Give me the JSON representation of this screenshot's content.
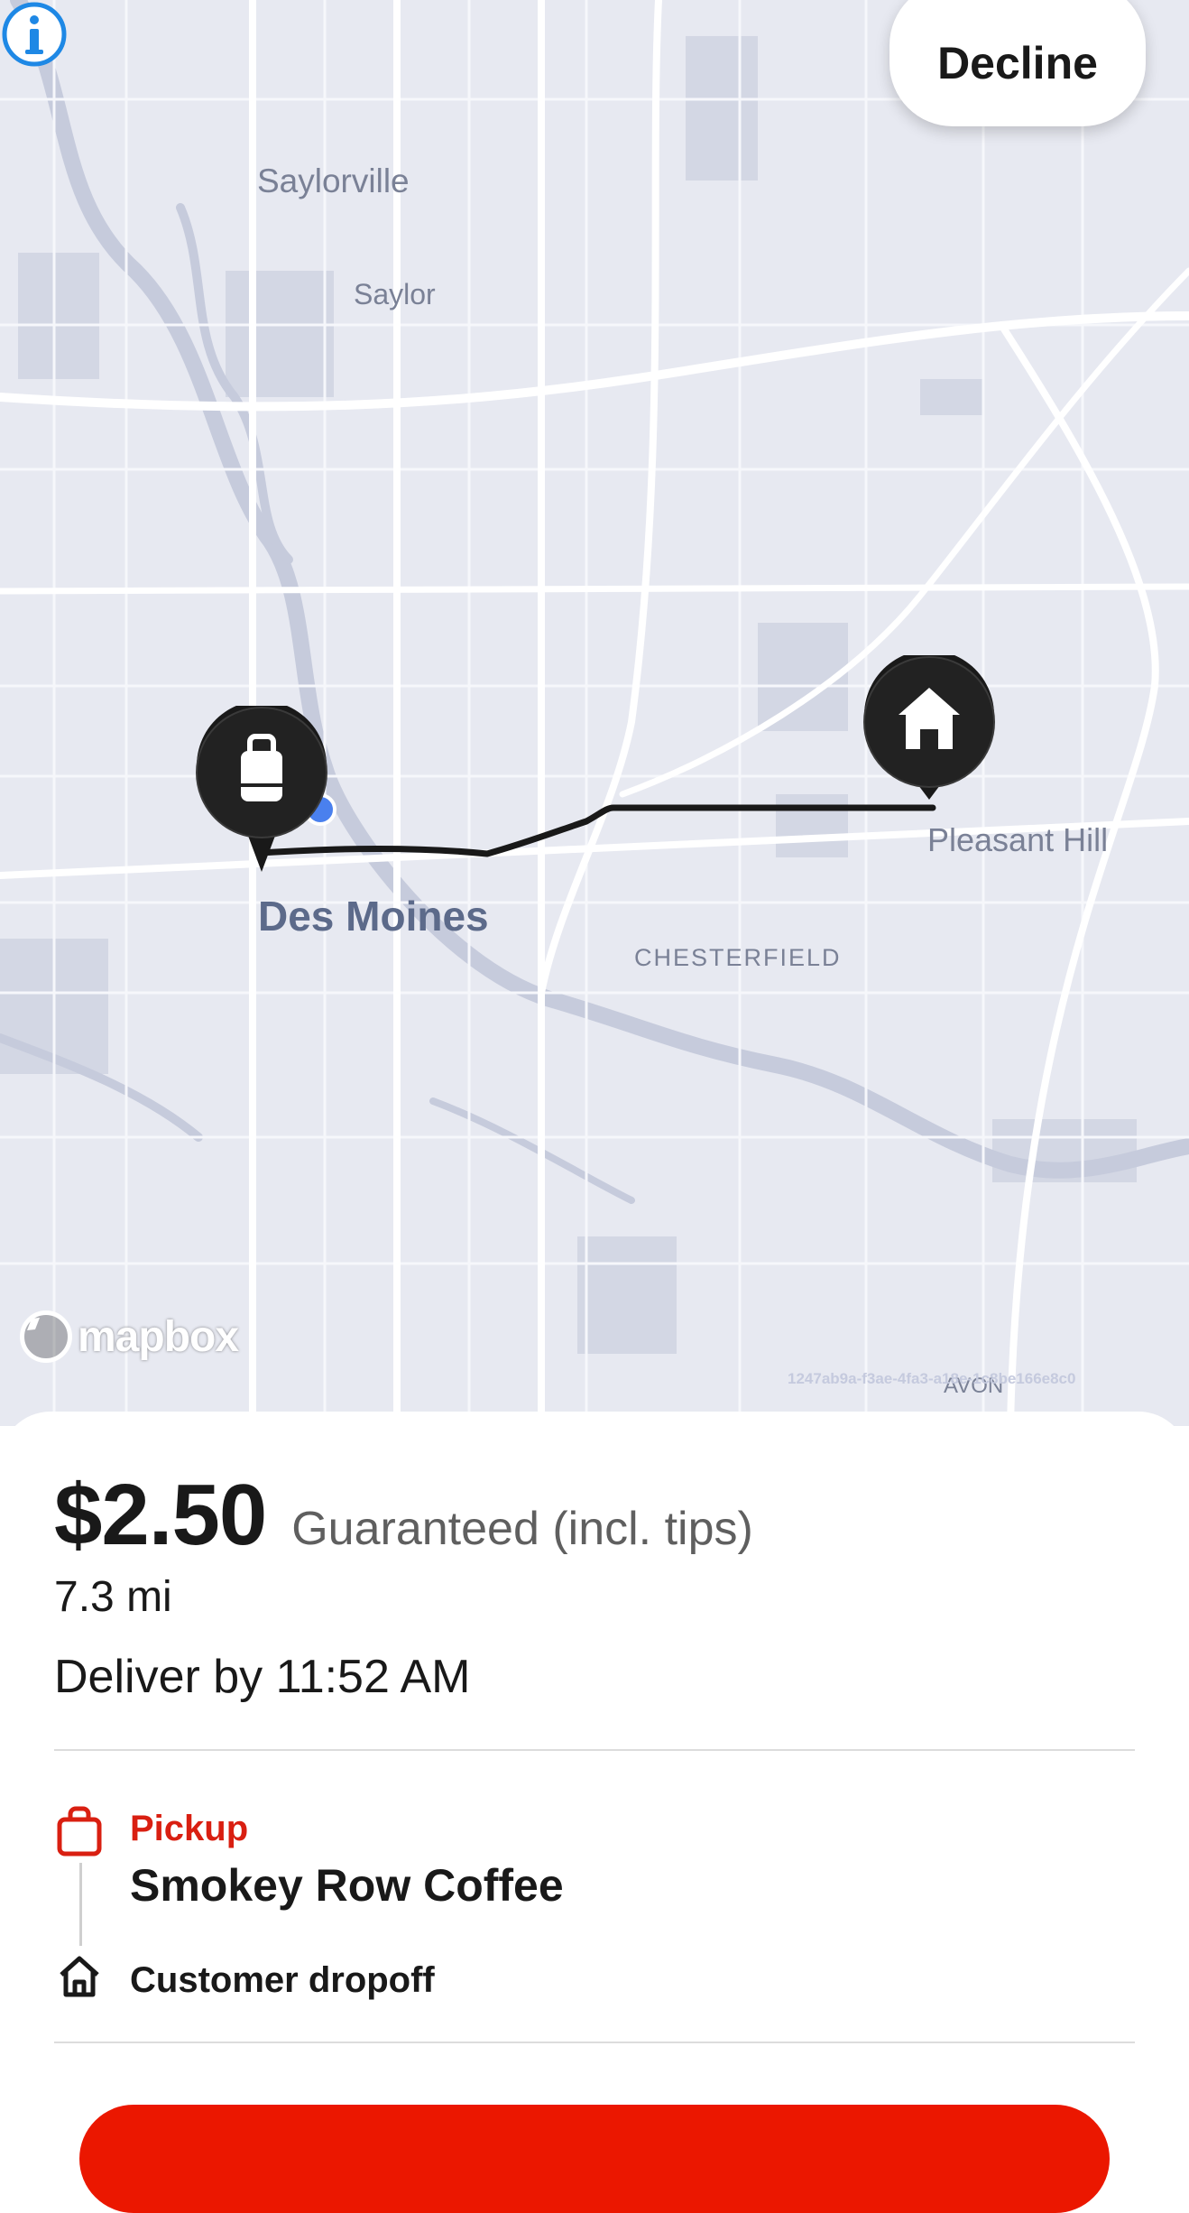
{
  "header": {
    "decline_label": "Decline"
  },
  "map": {
    "labels": {
      "saylorville": "Saylorville",
      "saylor": "Saylor",
      "des_moines": "Des Moines",
      "chesterfield": "CHESTERFIELD",
      "pleasant_hill": "Pleasant Hill",
      "avon": "AVON"
    },
    "attribution": {
      "logo_text": "mapbox",
      "id_text": "1247ab9a-f3ae-4fa3-a18e-1c8be166e8c0"
    },
    "pins": {
      "pickup_icon": "bag-icon",
      "dropoff_icon": "home-icon"
    }
  },
  "offer": {
    "price": "$2.50",
    "price_note": "Guaranteed (incl. tips)",
    "distance": "7.3 mi",
    "deliver_by": "Deliver by 11:52 AM"
  },
  "stops": {
    "pickup_label": "Pickup",
    "pickup_name": "Smokey Row Coffee",
    "dropoff_label": "Customer dropoff"
  },
  "colors": {
    "accent": "#eb1700",
    "pickup_label": "#d91f11",
    "route": "#191919",
    "map_bg": "#e7e9f1",
    "info": "#1e88e5"
  }
}
